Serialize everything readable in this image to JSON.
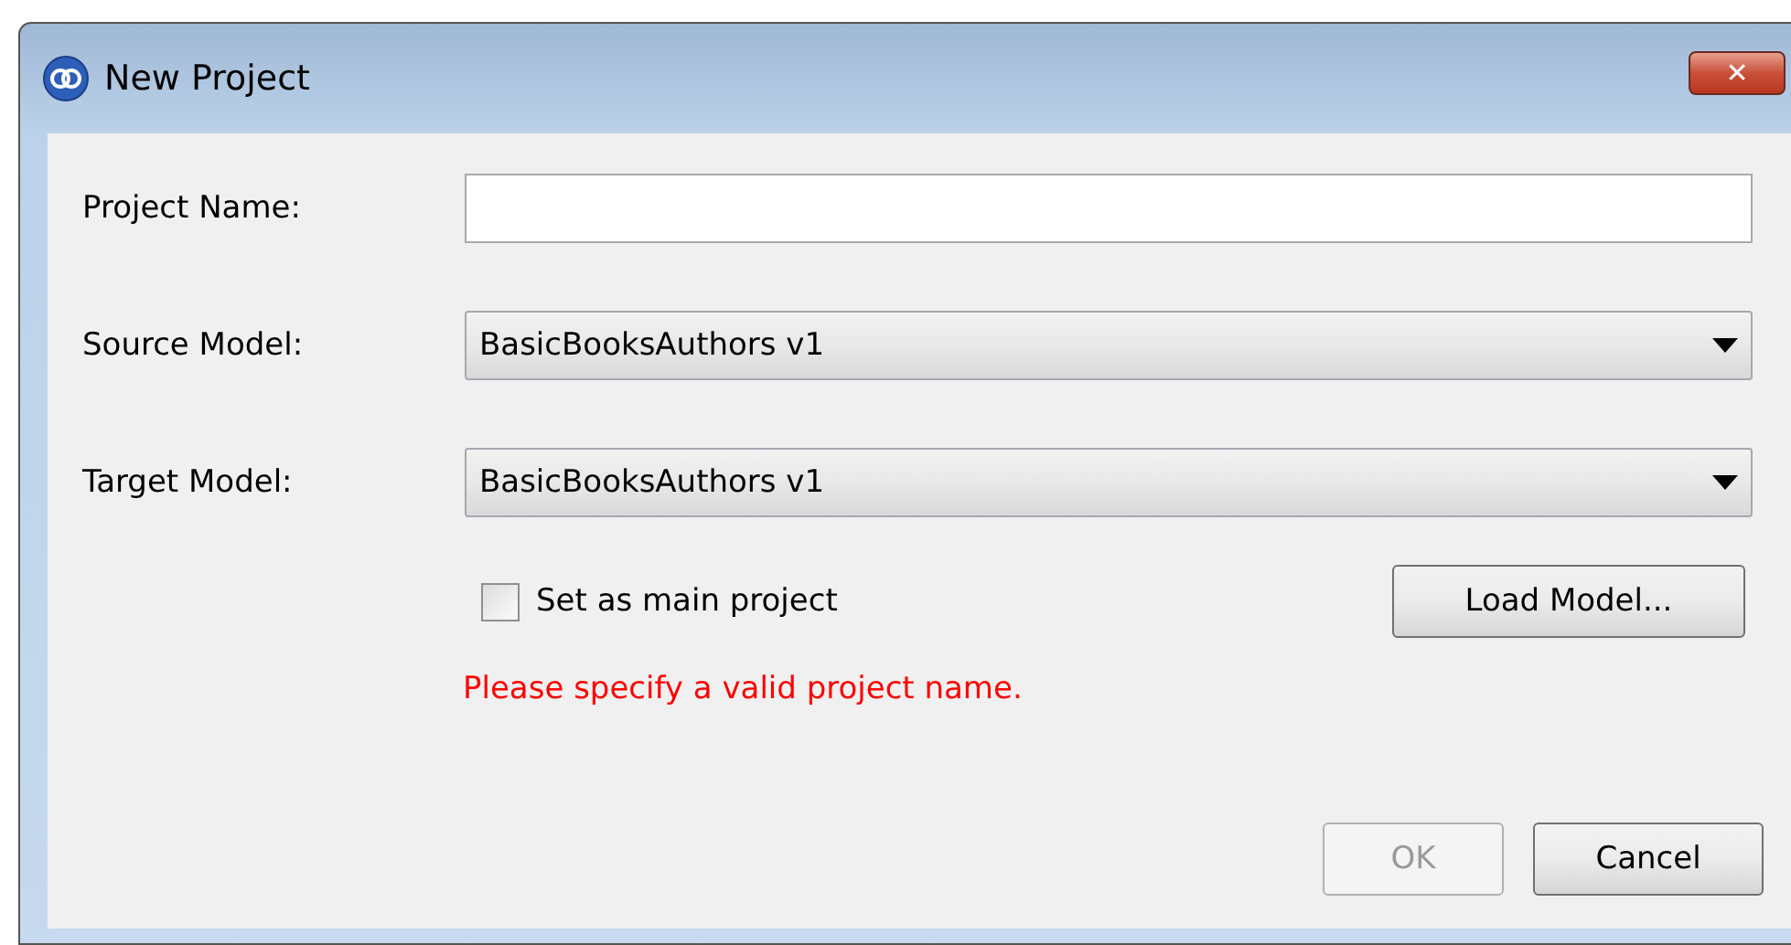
{
  "window": {
    "title": "New Project",
    "close_label": "✕"
  },
  "fields": [
    {
      "kind": "text",
      "label": "Project Name:"
    },
    {
      "kind": "combo",
      "label": "Source Model:",
      "value": "BasicBooksAuthors v1"
    },
    {
      "kind": "combo",
      "label": "Target Model:",
      "value": "BasicBooksAuthors v1"
    }
  ],
  "main_project": {
    "label": "Set as main project",
    "checked": false
  },
  "load_button": {
    "label": "Load Model..."
  },
  "error": "Please specify a valid project name.",
  "buttons": [
    {
      "label": "OK",
      "disabled": true
    },
    {
      "label": "Cancel",
      "disabled": false
    }
  ]
}
